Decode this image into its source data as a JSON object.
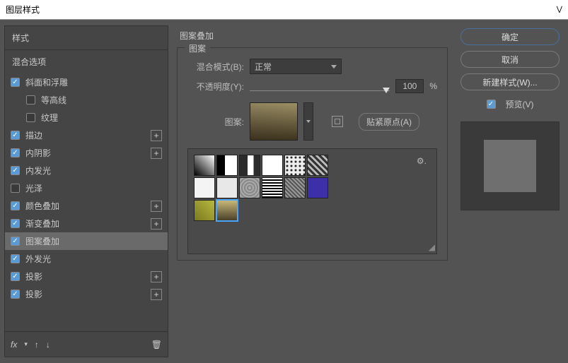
{
  "window": {
    "title": "图层样式"
  },
  "left": {
    "styles_header": "样式",
    "blend_header": "混合选项",
    "items": [
      {
        "label": "斜面和浮雕",
        "checked": true,
        "hasPlus": false,
        "indent": 0
      },
      {
        "label": "等高线",
        "checked": false,
        "hasPlus": false,
        "indent": 1
      },
      {
        "label": "纹理",
        "checked": false,
        "hasPlus": false,
        "indent": 1
      },
      {
        "label": "描边",
        "checked": true,
        "hasPlus": true,
        "indent": 0
      },
      {
        "label": "内阴影",
        "checked": true,
        "hasPlus": true,
        "indent": 0
      },
      {
        "label": "内发光",
        "checked": true,
        "hasPlus": false,
        "indent": 0
      },
      {
        "label": "光泽",
        "checked": false,
        "hasPlus": false,
        "indent": 0
      },
      {
        "label": "颜色叠加",
        "checked": true,
        "hasPlus": true,
        "indent": 0
      },
      {
        "label": "渐变叠加",
        "checked": true,
        "hasPlus": true,
        "indent": 0
      },
      {
        "label": "图案叠加",
        "checked": true,
        "hasPlus": false,
        "indent": 0,
        "selected": true
      },
      {
        "label": "外发光",
        "checked": true,
        "hasPlus": false,
        "indent": 0
      },
      {
        "label": "投影",
        "checked": true,
        "hasPlus": true,
        "indent": 0
      },
      {
        "label": "投影",
        "checked": true,
        "hasPlus": true,
        "indent": 0
      }
    ],
    "footer": {
      "fx": "fx"
    }
  },
  "center": {
    "title": "图案叠加",
    "fieldset": "图案",
    "blend_mode_label": "混合模式(B):",
    "blend_mode_value": "正常",
    "opacity_label": "不透明度(Y):",
    "opacity_value": "100",
    "opacity_unit": "%",
    "pattern_label": "图案:",
    "snap_label": "贴紧原点(A)"
  },
  "right": {
    "ok": "确定",
    "cancel": "取消",
    "new_style": "新建样式(W)...",
    "preview": "预览(V)"
  },
  "swatches": [
    {
      "style": "background:linear-gradient(45deg,#000,#fff)"
    },
    {
      "style": "background:linear-gradient(90deg,#000 40%,#fff 40%)"
    },
    {
      "style": "background:linear-gradient(90deg,#2b2b2b 40%,#fff 40%,#fff 70%,#2b2b2b 70%)"
    },
    {
      "style": "background:#fff"
    },
    {
      "style": "background:radial-gradient(circle,#222 1px,#eee 2px);background-size:6px 6px"
    },
    {
      "style": "background:repeating-linear-gradient(45deg,#333 0 3px,#bbb 3px 6px)"
    },
    {
      "style": "background:#f4f4f4"
    },
    {
      "style": "background:#e8e8e8"
    },
    {
      "style": "background:repeating-radial-gradient(circle,#aaa 0 2px,#888 2px 4px)"
    },
    {
      "style": "background:repeating-linear-gradient(0deg,#000 0 2px,#fff 2px 4px),repeating-linear-gradient(90deg,#000 0 2px,transparent 2px 4px)"
    },
    {
      "style": "background:repeating-linear-gradient(45deg,#555 0 2px,#999 2px 4px)"
    },
    {
      "style": "background:#3d2fa8"
    },
    {
      "style": "background:linear-gradient(45deg,#7a7a20,#b8b840)"
    },
    {
      "style": "background:linear-gradient(180deg,#c8b878,#4a4028)",
      "selected": true
    }
  ]
}
